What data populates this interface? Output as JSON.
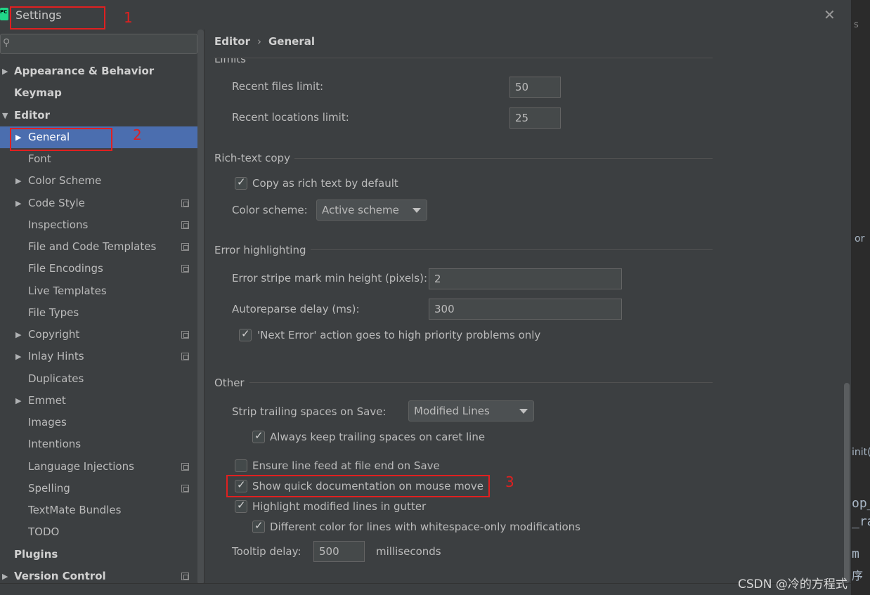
{
  "window": {
    "title": "Settings",
    "close_glyph": "✕"
  },
  "search": {
    "placeholder": "",
    "icon": "search-icon"
  },
  "sidebar": {
    "items": [
      {
        "label": "Appearance & Behavior",
        "arrow": "▶"
      },
      {
        "label": "Keymap"
      },
      {
        "label": "Editor",
        "arrow": "▼"
      },
      {
        "label": "General",
        "arrow": "▶"
      },
      {
        "label": "Font"
      },
      {
        "label": "Color Scheme",
        "arrow": "▶"
      },
      {
        "label": "Code Style",
        "arrow": "▶"
      },
      {
        "label": "Inspections"
      },
      {
        "label": "File and Code Templates"
      },
      {
        "label": "File Encodings"
      },
      {
        "label": "Live Templates"
      },
      {
        "label": "File Types"
      },
      {
        "label": "Copyright",
        "arrow": "▶"
      },
      {
        "label": "Inlay Hints",
        "arrow": "▶"
      },
      {
        "label": "Duplicates"
      },
      {
        "label": "Emmet",
        "arrow": "▶"
      },
      {
        "label": "Images"
      },
      {
        "label": "Intentions"
      },
      {
        "label": "Language Injections"
      },
      {
        "label": "Spelling"
      },
      {
        "label": "TextMate Bundles"
      },
      {
        "label": "TODO"
      },
      {
        "label": "Plugins"
      },
      {
        "label": "Version Control",
        "arrow": "▶"
      }
    ]
  },
  "breadcrumb": {
    "parent": "Editor",
    "separator": "›",
    "current": "General"
  },
  "limits": {
    "title": "Limits",
    "recent_files_label": "Recent files limit:",
    "recent_files_value": "50",
    "recent_locations_label": "Recent locations limit:",
    "recent_locations_value": "25"
  },
  "rich_text": {
    "title": "Rich-text copy",
    "copy_rich_label": "Copy as rich text by default",
    "color_scheme_label": "Color scheme:",
    "color_scheme_value": "Active scheme"
  },
  "error_highlighting": {
    "title": "Error highlighting",
    "stripe_label": "Error stripe mark min height (pixels):",
    "stripe_value": "2",
    "autoreparse_label": "Autoreparse delay (ms):",
    "autoreparse_value": "300",
    "next_error_label": "'Next Error' action goes to high priority problems only"
  },
  "other": {
    "title": "Other",
    "strip_label": "Strip trailing spaces on Save:",
    "strip_value": "Modified Lines",
    "keep_trailing_label": "Always keep trailing spaces on caret line",
    "line_feed_label": "Ensure line feed at file end on Save",
    "quick_doc_label": "Show quick documentation on mouse move",
    "highlight_modified_label": "Highlight modified lines in gutter",
    "whitespace_color_label": "Different color for lines with whitespace-only modifications",
    "tooltip_label": "Tooltip delay:",
    "tooltip_value": "500",
    "tooltip_unit": "milliseconds"
  },
  "annotations": {
    "one": "1",
    "two": "2",
    "three": "3"
  },
  "background_ide": {
    "text1": "or",
    "text2": "init(",
    "text3": "op_",
    "text4": "_ra",
    "text5": "m",
    "text6": "序",
    "text7": "s"
  },
  "watermark": "CSDN @冷的方程式",
  "colors": {
    "selection": "#4b6eaf",
    "annotation": "#e02020",
    "background": "#3c3f41"
  }
}
